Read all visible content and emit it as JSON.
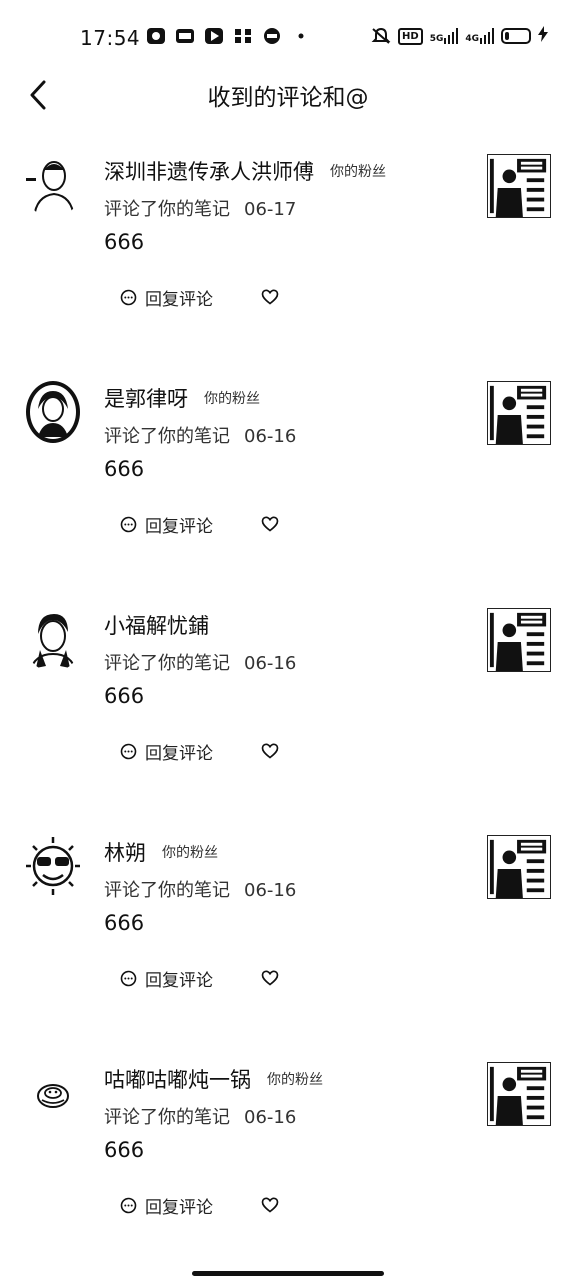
{
  "status_bar": {
    "time": "17:54",
    "network_5g": "5G",
    "network_4g": "4G",
    "hd": "HD",
    "battery_level": 0.3
  },
  "header": {
    "title": "收到的评论和@"
  },
  "comments": [
    {
      "name": "深圳非遗传承人洪师傅",
      "badge": "你的粉丝",
      "action": "评论了你的笔记",
      "date": "06-17",
      "text": "666",
      "reply_label": "回复评论"
    },
    {
      "name": "是郭律呀",
      "badge": "你的粉丝",
      "action": "评论了你的笔记",
      "date": "06-16",
      "text": "666",
      "reply_label": "回复评论"
    },
    {
      "name": "小福解忧鋪",
      "badge": "",
      "action": "评论了你的笔记",
      "date": "06-16",
      "text": "666",
      "reply_label": "回复评论"
    },
    {
      "name": "林朔",
      "badge": "你的粉丝",
      "action": "评论了你的笔记",
      "date": "06-16",
      "text": "666",
      "reply_label": "回复评论"
    },
    {
      "name": "咕嘟咕嘟炖一锅",
      "badge": "你的粉丝",
      "action": "评论了你的笔记",
      "date": "06-16",
      "text": "666",
      "reply_label": "回复评论"
    }
  ]
}
